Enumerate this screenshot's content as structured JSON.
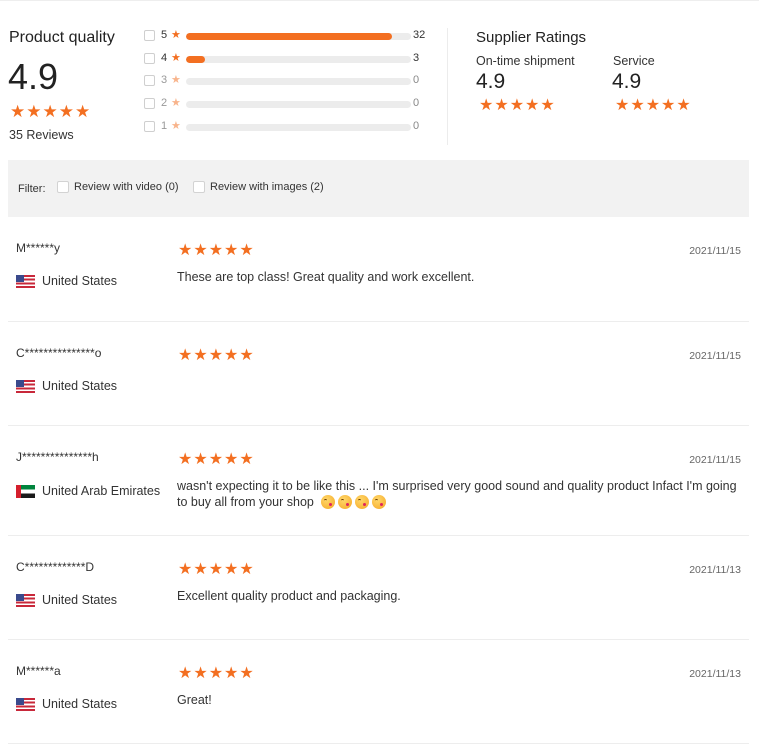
{
  "summary": {
    "title": "Product quality",
    "score": "4.9",
    "stars": 5,
    "reviews_text": "35 Reviews"
  },
  "distribution": [
    {
      "stars": "5",
      "count": "32",
      "fraction": 0.914
    },
    {
      "stars": "4",
      "count": "3",
      "fraction": 0.086
    },
    {
      "stars": "3",
      "count": "0",
      "fraction": 0
    },
    {
      "stars": "2",
      "count": "0",
      "fraction": 0
    },
    {
      "stars": "1",
      "count": "0",
      "fraction": 0
    }
  ],
  "supplier": {
    "title": "Supplier Ratings",
    "metrics": [
      {
        "label": "On-time shipment",
        "score": "4.9",
        "stars": 5
      },
      {
        "label": "Service",
        "score": "4.9",
        "stars": 5
      }
    ]
  },
  "filter": {
    "label": "Filter:",
    "options": [
      {
        "label": "Review with video (0)"
      },
      {
        "label": "Review with images (2)"
      }
    ]
  },
  "reviews": [
    {
      "name": "M******y",
      "country": "United States",
      "flag": "us",
      "stars": 5,
      "date": "2021/11/15",
      "text": "These are top class! Great quality and work excellent.",
      "emojis": 0
    },
    {
      "name": "C***************o",
      "country": "United States",
      "flag": "us",
      "stars": 5,
      "date": "2021/11/15",
      "text": "",
      "emojis": 0
    },
    {
      "name": "J***************h",
      "country": "United Arab Emirates",
      "flag": "ae",
      "stars": 5,
      "date": "2021/11/15",
      "text": "wasn't expecting it to be like this ... I'm surprised very good sound and quality product Infact I'm going to buy all from your shop",
      "emojis": 4
    },
    {
      "name": "C*************D",
      "country": "United States",
      "flag": "us",
      "stars": 5,
      "date": "2021/11/13",
      "text": "Excellent quality product and packaging.",
      "emojis": 0
    },
    {
      "name": "M******a",
      "country": "United States",
      "flag": "us",
      "stars": 5,
      "date": "2021/11/13",
      "text": "Great!",
      "emojis": 0
    }
  ],
  "colors": {
    "accent": "#f36f21",
    "track": "#ececec",
    "filter_bg": "#f2f2f2"
  },
  "icons": {
    "star": "star-icon",
    "flag_us": "flag-us-icon",
    "flag_ae": "flag-ae-icon",
    "emoji": "kissing-face-emoji"
  }
}
